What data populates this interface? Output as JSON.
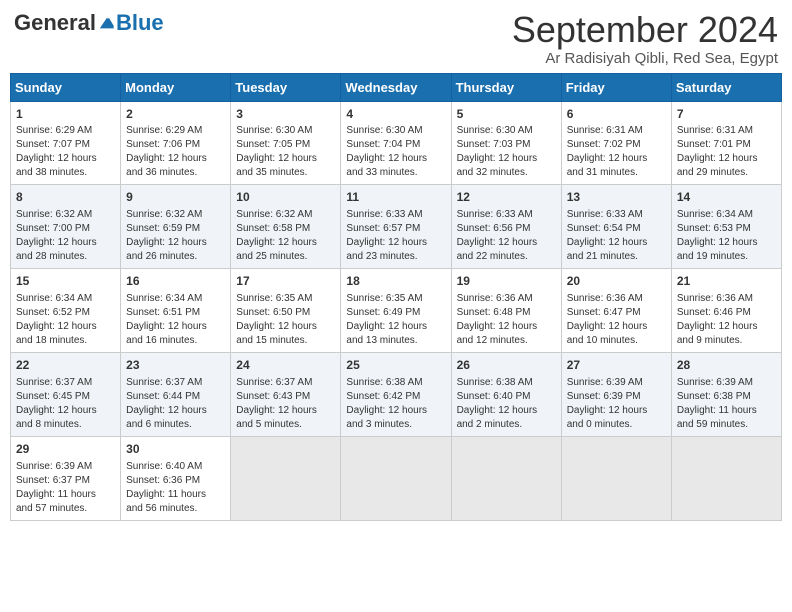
{
  "header": {
    "logo_general": "General",
    "logo_blue": "Blue",
    "month_title": "September 2024",
    "location": "Ar Radisiyah Qibli, Red Sea, Egypt"
  },
  "weekdays": [
    "Sunday",
    "Monday",
    "Tuesday",
    "Wednesday",
    "Thursday",
    "Friday",
    "Saturday"
  ],
  "weeks": [
    [
      {
        "day": "1",
        "sunrise": "6:29 AM",
        "sunset": "7:07 PM",
        "daylight": "12 hours and 38 minutes."
      },
      {
        "day": "2",
        "sunrise": "6:29 AM",
        "sunset": "7:06 PM",
        "daylight": "12 hours and 36 minutes."
      },
      {
        "day": "3",
        "sunrise": "6:30 AM",
        "sunset": "7:05 PM",
        "daylight": "12 hours and 35 minutes."
      },
      {
        "day": "4",
        "sunrise": "6:30 AM",
        "sunset": "7:04 PM",
        "daylight": "12 hours and 33 minutes."
      },
      {
        "day": "5",
        "sunrise": "6:30 AM",
        "sunset": "7:03 PM",
        "daylight": "12 hours and 32 minutes."
      },
      {
        "day": "6",
        "sunrise": "6:31 AM",
        "sunset": "7:02 PM",
        "daylight": "12 hours and 31 minutes."
      },
      {
        "day": "7",
        "sunrise": "6:31 AM",
        "sunset": "7:01 PM",
        "daylight": "12 hours and 29 minutes."
      }
    ],
    [
      {
        "day": "8",
        "sunrise": "6:32 AM",
        "sunset": "7:00 PM",
        "daylight": "12 hours and 28 minutes."
      },
      {
        "day": "9",
        "sunrise": "6:32 AM",
        "sunset": "6:59 PM",
        "daylight": "12 hours and 26 minutes."
      },
      {
        "day": "10",
        "sunrise": "6:32 AM",
        "sunset": "6:58 PM",
        "daylight": "12 hours and 25 minutes."
      },
      {
        "day": "11",
        "sunrise": "6:33 AM",
        "sunset": "6:57 PM",
        "daylight": "12 hours and 23 minutes."
      },
      {
        "day": "12",
        "sunrise": "6:33 AM",
        "sunset": "6:56 PM",
        "daylight": "12 hours and 22 minutes."
      },
      {
        "day": "13",
        "sunrise": "6:33 AM",
        "sunset": "6:54 PM",
        "daylight": "12 hours and 21 minutes."
      },
      {
        "day": "14",
        "sunrise": "6:34 AM",
        "sunset": "6:53 PM",
        "daylight": "12 hours and 19 minutes."
      }
    ],
    [
      {
        "day": "15",
        "sunrise": "6:34 AM",
        "sunset": "6:52 PM",
        "daylight": "12 hours and 18 minutes."
      },
      {
        "day": "16",
        "sunrise": "6:34 AM",
        "sunset": "6:51 PM",
        "daylight": "12 hours and 16 minutes."
      },
      {
        "day": "17",
        "sunrise": "6:35 AM",
        "sunset": "6:50 PM",
        "daylight": "12 hours and 15 minutes."
      },
      {
        "day": "18",
        "sunrise": "6:35 AM",
        "sunset": "6:49 PM",
        "daylight": "12 hours and 13 minutes."
      },
      {
        "day": "19",
        "sunrise": "6:36 AM",
        "sunset": "6:48 PM",
        "daylight": "12 hours and 12 minutes."
      },
      {
        "day": "20",
        "sunrise": "6:36 AM",
        "sunset": "6:47 PM",
        "daylight": "12 hours and 10 minutes."
      },
      {
        "day": "21",
        "sunrise": "6:36 AM",
        "sunset": "6:46 PM",
        "daylight": "12 hours and 9 minutes."
      }
    ],
    [
      {
        "day": "22",
        "sunrise": "6:37 AM",
        "sunset": "6:45 PM",
        "daylight": "12 hours and 8 minutes."
      },
      {
        "day": "23",
        "sunrise": "6:37 AM",
        "sunset": "6:44 PM",
        "daylight": "12 hours and 6 minutes."
      },
      {
        "day": "24",
        "sunrise": "6:37 AM",
        "sunset": "6:43 PM",
        "daylight": "12 hours and 5 minutes."
      },
      {
        "day": "25",
        "sunrise": "6:38 AM",
        "sunset": "6:42 PM",
        "daylight": "12 hours and 3 minutes."
      },
      {
        "day": "26",
        "sunrise": "6:38 AM",
        "sunset": "6:40 PM",
        "daylight": "12 hours and 2 minutes."
      },
      {
        "day": "27",
        "sunrise": "6:39 AM",
        "sunset": "6:39 PM",
        "daylight": "12 hours and 0 minutes."
      },
      {
        "day": "28",
        "sunrise": "6:39 AM",
        "sunset": "6:38 PM",
        "daylight": "11 hours and 59 minutes."
      }
    ],
    [
      {
        "day": "29",
        "sunrise": "6:39 AM",
        "sunset": "6:37 PM",
        "daylight": "11 hours and 57 minutes."
      },
      {
        "day": "30",
        "sunrise": "6:40 AM",
        "sunset": "6:36 PM",
        "daylight": "11 hours and 56 minutes."
      },
      {
        "day": "",
        "sunrise": "",
        "sunset": "",
        "daylight": ""
      },
      {
        "day": "",
        "sunrise": "",
        "sunset": "",
        "daylight": ""
      },
      {
        "day": "",
        "sunrise": "",
        "sunset": "",
        "daylight": ""
      },
      {
        "day": "",
        "sunrise": "",
        "sunset": "",
        "daylight": ""
      },
      {
        "day": "",
        "sunrise": "",
        "sunset": "",
        "daylight": ""
      }
    ]
  ]
}
